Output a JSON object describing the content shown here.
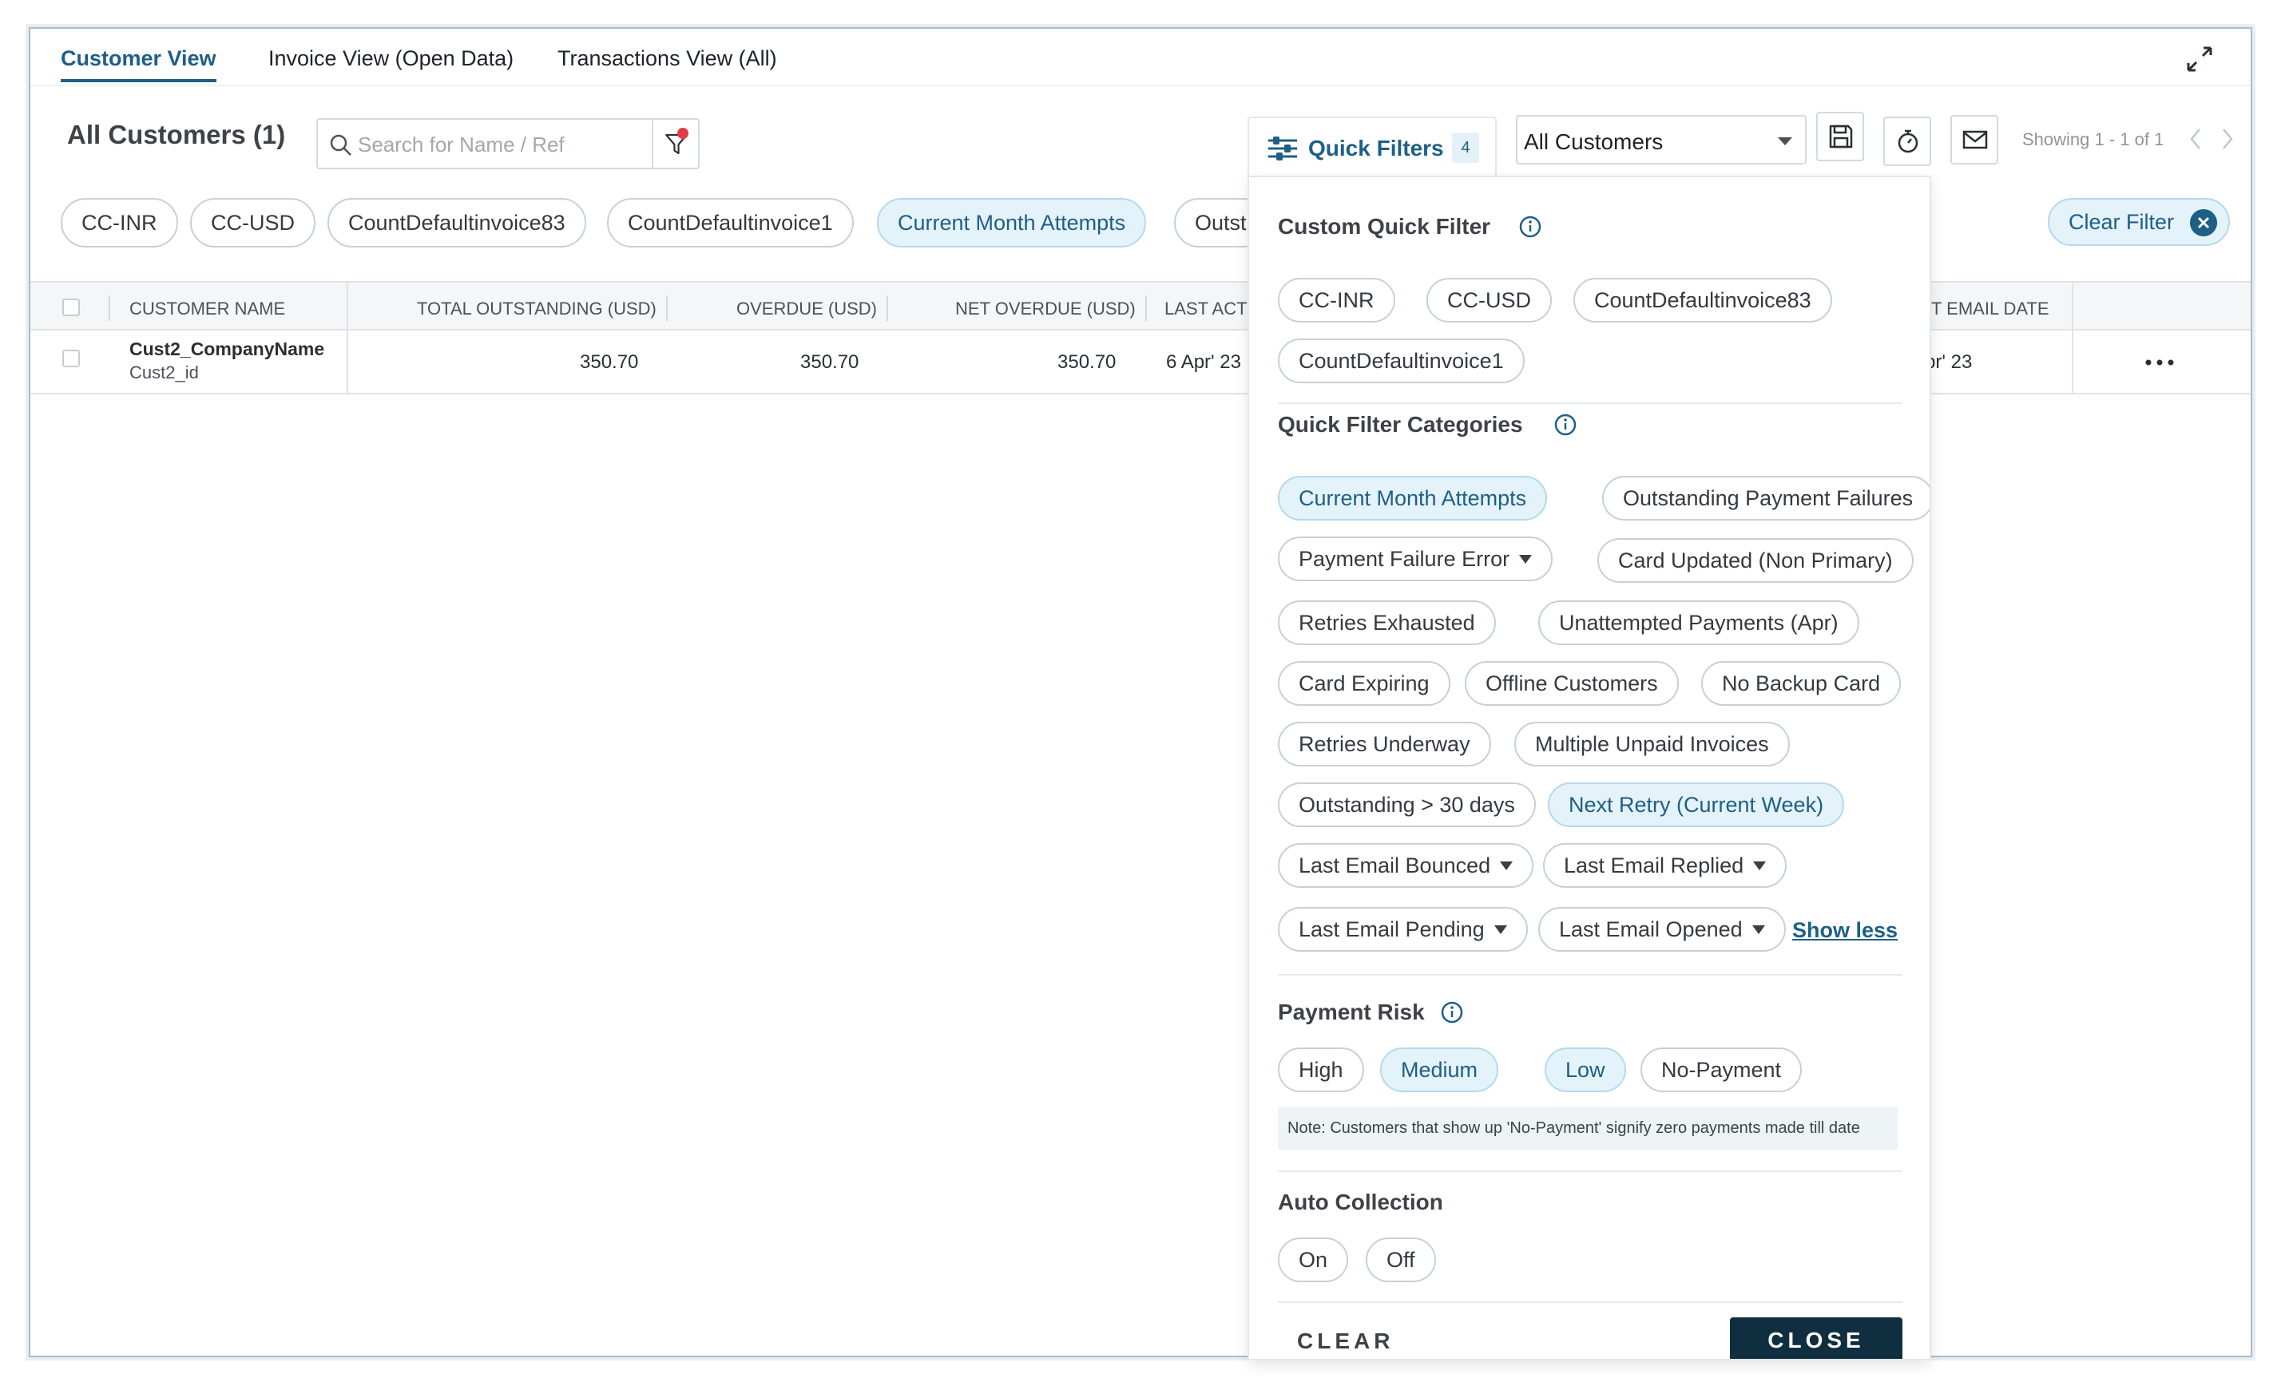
{
  "tabs": [
    {
      "label": "Customer View",
      "active": true
    },
    {
      "label": "Invoice View (Open Data)",
      "active": false
    },
    {
      "label": "Transactions View (All)",
      "active": false
    }
  ],
  "toolbar": {
    "title": "All Customers (1)",
    "search_placeholder": "Search for Name / Ref",
    "quick_filters_label": "Quick Filters",
    "quick_filters_count": "4",
    "customer_select": "All Customers",
    "showing": "Showing 1 - 1 of 1"
  },
  "active_chips": [
    {
      "label": "CC-INR",
      "selected": false
    },
    {
      "label": "CC-USD",
      "selected": false
    },
    {
      "label": "CountDefaultinvoice83",
      "selected": false
    },
    {
      "label": "CountDefaultinvoice1",
      "selected": false
    },
    {
      "label": "Current Month Attempts",
      "selected": true
    },
    {
      "label": "Outst",
      "selected": false
    }
  ],
  "clear_filter_label": "Clear Filter",
  "table": {
    "headers": {
      "customer_name": "CUSTOMER NAME",
      "total_outstanding": "TOTAL OUTSTANDING (USD)",
      "overdue": "OVERDUE (USD)",
      "net_overdue": "NET OVERDUE (USD)",
      "last_act": "LAST ACT",
      "last_email_date": "T EMAIL DATE"
    },
    "rows": [
      {
        "company": "Cust2_CompanyName",
        "id": "Cust2_id",
        "total_outstanding": "350.70",
        "overdue": "350.70",
        "net_overdue": "350.70",
        "last_act": "6 Apr' 23",
        "last_email_date": "pr' 23"
      }
    ]
  },
  "panel": {
    "custom_title": "Custom Quick Filter",
    "custom_chips": [
      "CC-INR",
      "CC-USD",
      "CountDefaultinvoice83",
      "CountDefaultinvoice1"
    ],
    "categories_title": "Quick Filter Categories",
    "categories": [
      {
        "label": "Current Month Attempts",
        "selected": true,
        "dropdown": false
      },
      {
        "label": "Outstanding Payment Failures",
        "selected": false,
        "dropdown": false
      },
      {
        "label": "Payment Failure Error",
        "selected": false,
        "dropdown": true
      },
      {
        "label": "Card Updated (Non Primary)",
        "selected": false,
        "dropdown": false
      },
      {
        "label": "Retries Exhausted",
        "selected": false,
        "dropdown": false
      },
      {
        "label": "Unattempted Payments (Apr)",
        "selected": false,
        "dropdown": false
      },
      {
        "label": "Card Expiring",
        "selected": false,
        "dropdown": false
      },
      {
        "label": "Offline Customers",
        "selected": false,
        "dropdown": false
      },
      {
        "label": "No Backup Card",
        "selected": false,
        "dropdown": false
      },
      {
        "label": "Retries Underway",
        "selected": false,
        "dropdown": false
      },
      {
        "label": "Multiple Unpaid Invoices",
        "selected": false,
        "dropdown": false
      },
      {
        "label": "Outstanding > 30 days",
        "selected": false,
        "dropdown": false
      },
      {
        "label": "Next Retry (Current Week)",
        "selected": true,
        "dropdown": false
      },
      {
        "label": "Last Email Bounced",
        "selected": false,
        "dropdown": true
      },
      {
        "label": "Last Email Replied",
        "selected": false,
        "dropdown": true
      },
      {
        "label": "Last Email Pending",
        "selected": false,
        "dropdown": true
      },
      {
        "label": "Last Email Opened",
        "selected": false,
        "dropdown": true
      }
    ],
    "show_less": "Show less",
    "risk_title": "Payment Risk",
    "risk_chips": [
      {
        "label": "High",
        "selected": false
      },
      {
        "label": "Medium",
        "selected": true
      },
      {
        "label": "Low",
        "selected": true
      },
      {
        "label": "No-Payment",
        "selected": false
      }
    ],
    "risk_note": "Note: Customers that show up 'No-Payment' signify zero payments made till date",
    "auto_title": "Auto Collection",
    "auto_chips": [
      "On",
      "Off"
    ],
    "clear_label": "CLEAR",
    "close_label": "CLOSE"
  },
  "colors": {
    "accent": "#1e5f86",
    "selected_bg": "#e4f2f9",
    "close_bg": "#0f2f40",
    "alert_dot": "#e63946"
  }
}
